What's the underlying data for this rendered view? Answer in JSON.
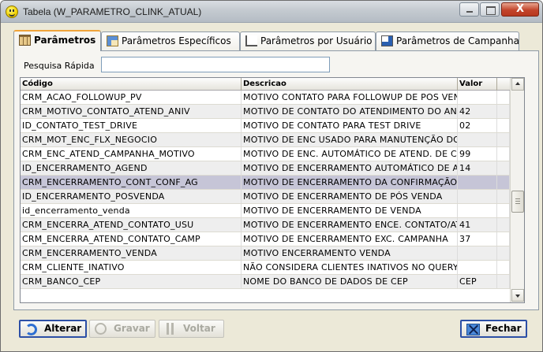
{
  "window": {
    "title": "Tabela (W_PARAMETRO_CLINK_ATUAL)",
    "close_label": "X"
  },
  "tabs": [
    {
      "label": "Parâmetros",
      "icon": "parameters-grid-icon",
      "active": true
    },
    {
      "label": "Parâmetros Específicos",
      "icon": "specific-params-icon",
      "active": false
    },
    {
      "label": "Parâmetros por Usuário",
      "icon": "user-params-icon",
      "active": false
    },
    {
      "label": "Parâmetros de Campanha",
      "icon": "campaign-params-icon",
      "active": false
    }
  ],
  "search": {
    "label": "Pesquisa Rápida",
    "value": "",
    "placeholder": ""
  },
  "table": {
    "columns": [
      "Código",
      "Descricao",
      "Valor"
    ],
    "selected_index": 6,
    "rows": [
      {
        "codigo": "CRM_ACAO_FOLLOWUP_PV",
        "descricao": "MOTIVO CONTATO PARA FOLLOWUP DE POS VEN",
        "valor": ""
      },
      {
        "codigo": "CRM_MOTIVO_CONTATO_ATEND_ANIV",
        "descricao": "MOTIVO DE CONTATO DO ATENDIMENTO DO ANI",
        "valor": "42"
      },
      {
        "codigo": "ID_CONTATO_TEST_DRIVE",
        "descricao": "MOTIVO DE CONTATO PARA TEST DRIVE",
        "valor": "02"
      },
      {
        "codigo": "CRM_MOT_ENC_FLX_NEGOCIO",
        "descricao": "MOTIVO DE ENC USADO PARA MANUTENÇÃO DO",
        "valor": ""
      },
      {
        "codigo": "CRM_ENC_ATEND_CAMPANHA_MOTIVO",
        "descricao": "MOTIVO DE ENC. AUTOMÁTICO DE ATEND. DE CA",
        "valor": "99"
      },
      {
        "codigo": "ID_ENCERRAMENTO_AGEND",
        "descricao": "MOTIVO DE ENCERRAMENTO AUTOMÁTICO DE AG",
        "valor": "14"
      },
      {
        "codigo": "CRM_ENCERRAMENTO_CONT_CONF_AG",
        "descricao": "MOTIVO DE ENCERRAMENTO DA CONFIRMAÇÃO A",
        "valor": ""
      },
      {
        "codigo": "ID_ENCERRAMENTO_POSVENDA",
        "descricao": "MOTIVO DE ENCERRAMENTO DE PÓS VENDA",
        "valor": ""
      },
      {
        "codigo": "id_encerramento_venda",
        "descricao": "MOTIVO DE ENCERRAMENTO DE VENDA",
        "valor": ""
      },
      {
        "codigo": "CRM_ENCERRA_ATEND_CONTATO_USU",
        "descricao": "MOTIVO DE ENCERRAMENTO ENCE. CONTATO/AT",
        "valor": "41"
      },
      {
        "codigo": "CRM_ENCERRA_ATEND_CONTATO_CAMP",
        "descricao": "MOTIVO DE ENCERRAMENTO EXC. CAMPANHA",
        "valor": "37"
      },
      {
        "codigo": "CRM_ENCERRAMENTO_VENDA",
        "descricao": "MOTIVO ENCERRAMENTO VENDA",
        "valor": ""
      },
      {
        "codigo": "CRM_CLIENTE_INATIVO",
        "descricao": "NÃO CONSIDERA CLIENTES INATIVOS NO QUERYS",
        "valor": ""
      },
      {
        "codigo": "CRM_BANCO_CEP",
        "descricao": "NOME DO BANCO DE DADOS DE CEP",
        "valor": "CEP"
      }
    ]
  },
  "buttons": {
    "alterar": {
      "label": "Alterar",
      "enabled": true,
      "icon": "refresh-icon"
    },
    "gravar": {
      "label": "Gravar",
      "enabled": false,
      "icon": "save-icon"
    },
    "voltar": {
      "label": "Voltar",
      "enabled": false,
      "icon": "back-icon"
    },
    "fechar": {
      "label": "Fechar",
      "enabled": true,
      "icon": "close-x-icon"
    }
  },
  "colors": {
    "selected_row": "#c6c5d7",
    "active_tab_accent": "#f0a43a",
    "close_button": "#c2442a"
  }
}
